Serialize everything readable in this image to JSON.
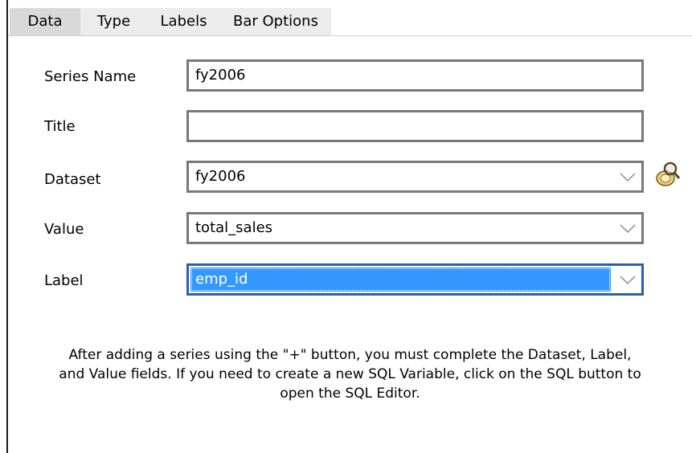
{
  "tabs": [
    {
      "label": "Data",
      "active": true
    },
    {
      "label": "Type",
      "active": false
    },
    {
      "label": "Labels",
      "active": false
    },
    {
      "label": "Bar Options",
      "active": false
    }
  ],
  "form": {
    "series_name": {
      "label": "Series Name",
      "value": "fy2006"
    },
    "title": {
      "label": "Title",
      "value": ""
    },
    "dataset": {
      "label": "Dataset",
      "value": "fy2006"
    },
    "value": {
      "label": "Value",
      "value": "total_sales"
    },
    "label": {
      "label": "Label",
      "value": "emp_id"
    }
  },
  "icons": {
    "sql_button": "sql-magnifier-icon",
    "dropdown": "chevron-down-icon"
  },
  "colors": {
    "selection": "#3399ff",
    "selection_border": "#2c5fb2"
  },
  "help": {
    "line1": "After adding a series using the \"+\" button, you must complete the Dataset, Label,",
    "line2": "and Value fields. If you need to create a new SQL Variable, click on the SQL button to",
    "line3": "open the SQL Editor."
  }
}
